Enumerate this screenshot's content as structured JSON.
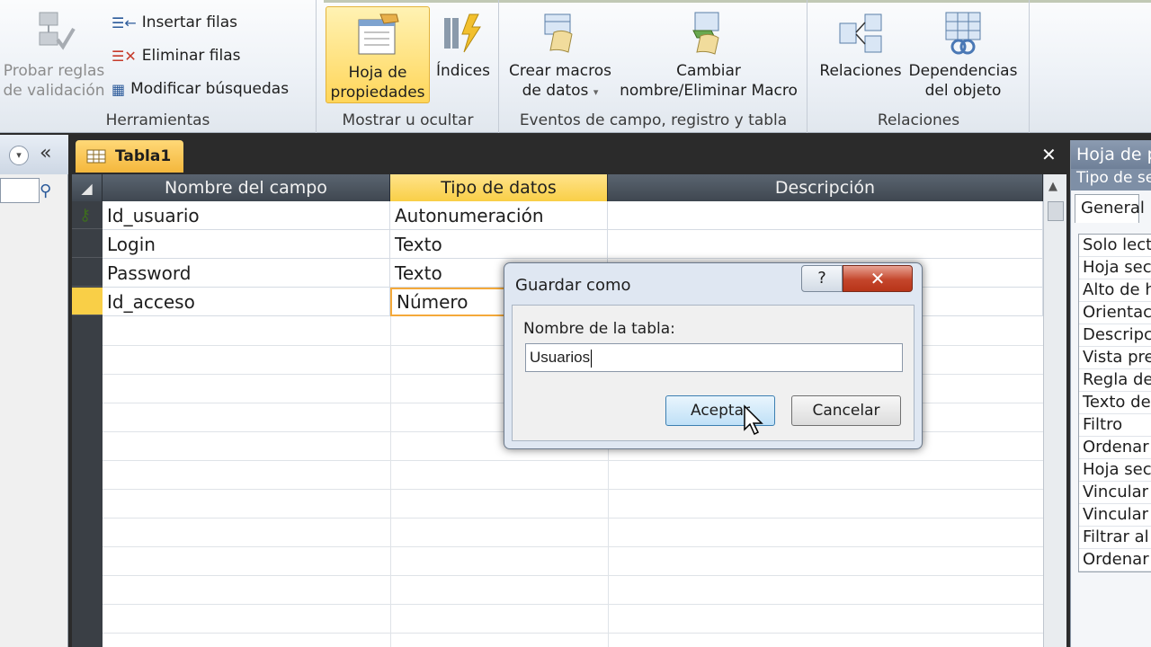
{
  "ribbon": {
    "herramientas": {
      "label": "Herramientas",
      "probar_reglas": "Probar reglas",
      "probar_reglas_2": "de validación",
      "insertar_filas": "Insertar filas",
      "eliminar_filas": "Eliminar filas",
      "modificar_busquedas": "Modificar búsquedas"
    },
    "mostrar": {
      "label": "Mostrar u ocultar",
      "hoja_1": "Hoja de",
      "hoja_2": "propiedades",
      "indices": "Índices"
    },
    "eventos": {
      "label": "Eventos de campo, registro y tabla",
      "crear_1": "Crear macros",
      "crear_2": "de datos",
      "cambiar_1": "Cambiar",
      "cambiar_2": "nombre/Eliminar Macro"
    },
    "relaciones": {
      "label": "Relaciones",
      "relaciones_btn": "Relaciones",
      "dep_1": "Dependencias",
      "dep_2": "del objeto"
    }
  },
  "nav": {
    "collapse": "«",
    "dropdown": "▾"
  },
  "doc": {
    "tab_label": "Tabla1",
    "close": "✕",
    "headers": [
      "Nombre del campo",
      "Tipo de datos",
      "Descripción"
    ],
    "rows": [
      {
        "name": "Id_usuario",
        "type": "Autonumeración",
        "key": true
      },
      {
        "name": "Login",
        "type": "Texto"
      },
      {
        "name": "Password",
        "type": "Texto"
      },
      {
        "name": "Id_acceso",
        "type": "Número",
        "current": true
      }
    ]
  },
  "props": {
    "title": "Hoja de p",
    "subtitle": "Tipo de se",
    "tab": "General",
    "items": [
      "Solo lectu",
      "Hoja secu",
      "Alto de h",
      "Orientaci",
      "Descripci",
      "Vista pre",
      "Regla de",
      "Texto de",
      "Filtro",
      "Ordenar",
      "Hoja secu",
      "Vincular",
      "Vincular",
      "Filtrar al",
      "Ordenar"
    ]
  },
  "dialog": {
    "title": "Guardar como",
    "help": "?",
    "close": "✕",
    "label": "Nombre de la tabla:",
    "value": "Usuarios",
    "ok": "Aceptar",
    "cancel": "Cancelar"
  },
  "colors": {
    "accent_gold": "#f9cf47",
    "header_dark": "#4a535d",
    "close_red": "#c4462c"
  }
}
